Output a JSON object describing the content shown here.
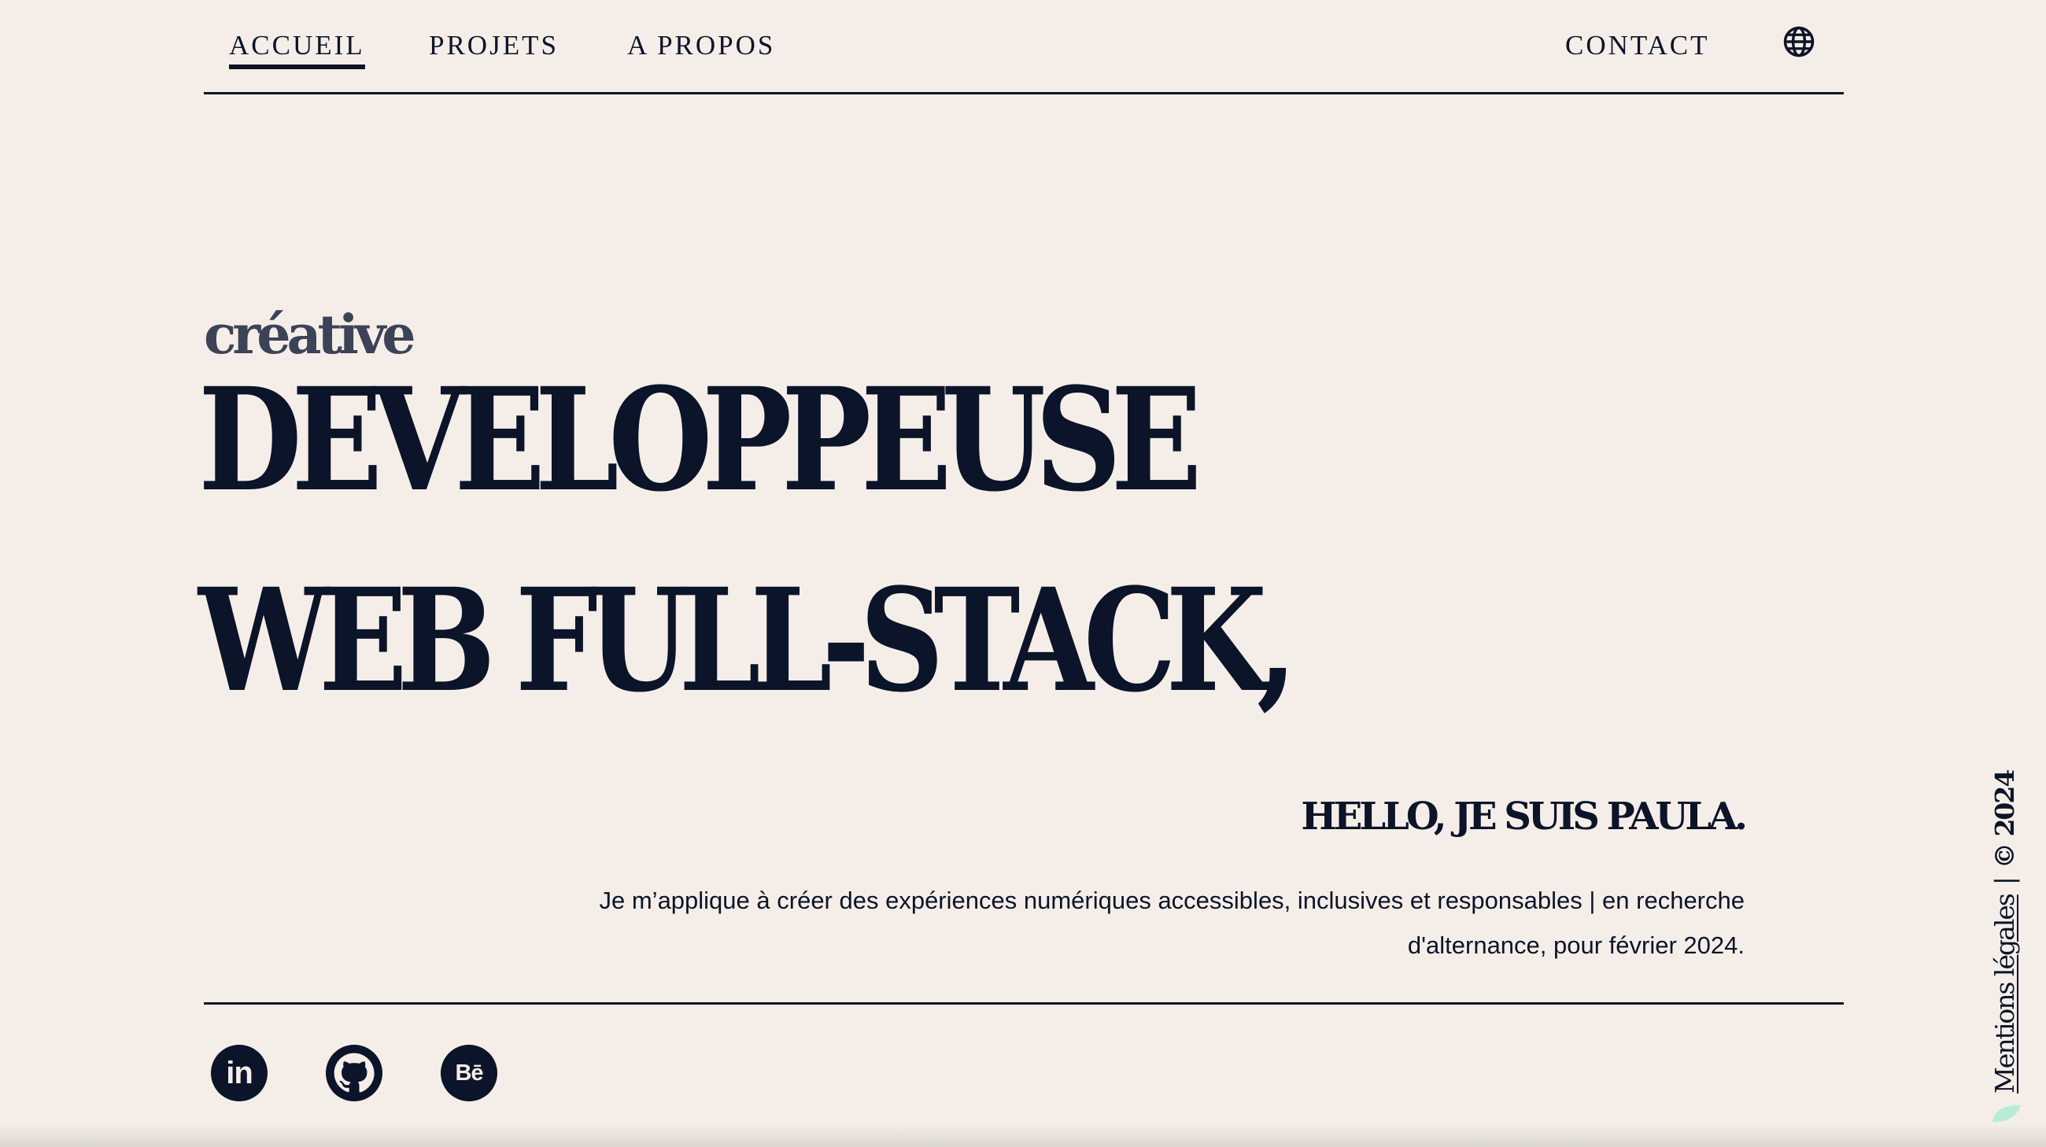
{
  "nav": {
    "links": [
      {
        "label": "ACCUEIL",
        "active": true
      },
      {
        "label": "PROJETS",
        "active": false
      },
      {
        "label": "A PROPOS",
        "active": false
      }
    ],
    "contact_label": "CONTACT",
    "language_icon": "globe-icon"
  },
  "hero": {
    "kicker": "créative",
    "line1": "DEVELOPPEUSE",
    "line2": "WEB FULL-STACK,",
    "greeting": "HELLO, JE SUIS PAULA.",
    "intro_line1": "Je m’applique à créer des expériences numériques accessibles, inclusives et responsables | en recherche",
    "intro_line2": "d'alternance, pour février 2024."
  },
  "social": {
    "linkedin_label": "in",
    "github_icon": "github-icon",
    "behance_label": "Bē"
  },
  "side": {
    "legal_label": "Mentions légales",
    "separator": "|",
    "copyright": "© 2024"
  },
  "colors": {
    "background": "#f5eee8",
    "ink": "#0c1429",
    "muted": "#3c4357",
    "accent_leaf": "#b8ecd6"
  }
}
